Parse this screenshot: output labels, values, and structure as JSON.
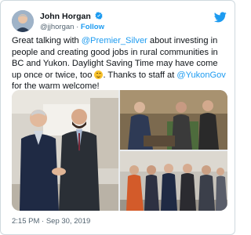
{
  "tweet": {
    "author": {
      "display_name": "John Horgan",
      "handle": "@jjhorgan",
      "separator": "·",
      "follow_label": "Follow"
    },
    "text_parts": [
      {
        "t": "Great talking with ",
        "mention": false
      },
      {
        "t": "@Premier_Silver",
        "mention": true
      },
      {
        "t": " about investing in people and creating good jobs in rural communities in BC and Yukon. Daylight Saving Time may have come up once or twice, too ",
        "mention": false
      },
      {
        "t": "emoji",
        "mention": false,
        "emoji": "smiling-face"
      },
      {
        "t": ". Thanks to staff at ",
        "mention": false
      },
      {
        "t": "@YukonGov",
        "mention": true
      },
      {
        "t": " for the warm welcome!",
        "mention": false
      }
    ],
    "timestamp": "2:15 PM · Sep 30, 2019"
  },
  "colors": {
    "accent": "#1d9bf0",
    "text": "#0f1419",
    "muted": "#536471",
    "border": "#cfd9de"
  },
  "icons": {
    "verified": "verified-badge-icon",
    "logo": "twitter-bird-icon"
  },
  "media": {
    "photo_count": 3
  }
}
